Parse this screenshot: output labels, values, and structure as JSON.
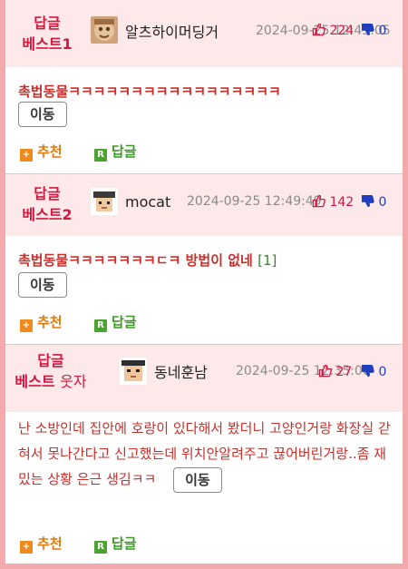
{
  "posts": [
    {
      "badge_line1": "답글",
      "badge_line2": "베스트1",
      "badge_tag": "",
      "author": "알츠하이머딩거",
      "date": "2024-09-25 12:45:05",
      "upvotes": "224",
      "downvotes": "0",
      "title": "촉법동물ㅋㅋㅋㅋㅋㅋㅋㅋㅋㅋㅋㅋㅋㅋㅋㅋㅋ",
      "reply_count": "",
      "move_label": "이동",
      "recommend_label": "추천",
      "reply_label": "답글"
    },
    {
      "badge_line1": "답글",
      "badge_line2": "베스트2",
      "badge_tag": "",
      "author": "mocat",
      "date": "2024-09-25 12:49:49",
      "upvotes": "142",
      "downvotes": "0",
      "title": "촉법동물ㅋㅋㅋㅋㅋㅋㅋㄷㅋ 방법이 없네",
      "reply_count": "[1]",
      "move_label": "이동",
      "recommend_label": "추천",
      "reply_label": "답글"
    },
    {
      "badge_line1": "답글",
      "badge_line2": "베스트",
      "badge_tag": "웃자",
      "author": "동네훈남",
      "date": "2024-09-25 12:35:00",
      "upvotes": "27",
      "downvotes": "0",
      "title": "난 소방인데 집안에 호랑이 있다해서 봤더니 고양인거랑 화장실 갇혀서 못나간다고 신고했는데 위치안알려주고 끊어버린거랑..좀 재밌는 상황 은근 생김ㅋㅋ",
      "reply_count": "",
      "move_label": "이동",
      "recommend_label": "추천",
      "reply_label": "답글"
    }
  ],
  "icons": {
    "thumb_up": "thumb-up-icon",
    "thumb_down": "thumb-down-icon",
    "recommend": "plus-square-icon",
    "reply": "r-square-icon"
  },
  "colors": {
    "accent_red": "#d3183f",
    "header_bg": "#fde9ea",
    "frame": "#f4a9ad",
    "recommend": "#f08a1c",
    "reply": "#4aa52f",
    "downvote": "#1f3fbf"
  }
}
